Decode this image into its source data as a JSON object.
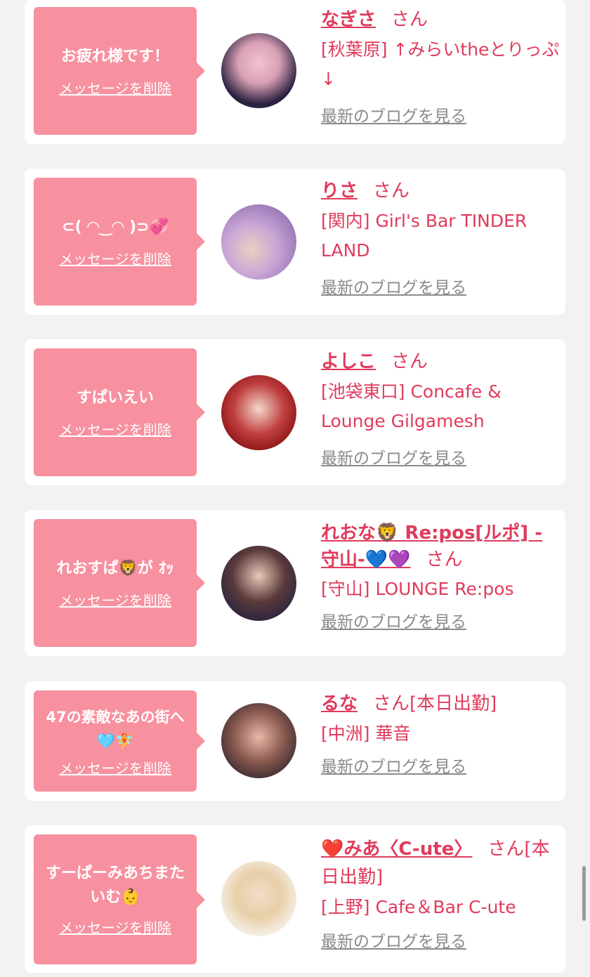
{
  "entries": [
    {
      "message": "お疲れ様です！",
      "delete_label": "メッセージを削除",
      "name": "なぎさ",
      "honorific": "さん",
      "shop": "[秋葉原] ↑みらいtheとりっぷ↓",
      "blog_label": "最新のブログを見る",
      "avatar_colors": [
        "#2a2140",
        "#f0c3d0"
      ]
    },
    {
      "message": "⊂( ◠‿◠ )⊃💞",
      "delete_label": "メッセージを削除",
      "name": "りさ",
      "honorific": "さん",
      "shop": "[関内] Girl's Bar TINDER LAND",
      "blog_label": "最新のブログを見る",
      "avatar_colors": [
        "#b08fc8",
        "#e8d0c0"
      ]
    },
    {
      "message": "すぱいえい",
      "delete_label": "メッセージを削除",
      "name": "よしこ",
      "honorific": "さん",
      "shop": "[池袋東口] Concafe & Lounge Gilgamesh",
      "blog_label": "最新のブログを見る",
      "avatar_colors": [
        "#b01818",
        "#f2d8cc"
      ]
    },
    {
      "message": "れおすぱ🦁が ｵｯ",
      "delete_label": "メッセージを削除",
      "name": "れおな🦁 Re:pos[ルポ] -守山-💙💜",
      "honorific": "さん",
      "shop": "[守山] LOUNGE Re:pos",
      "blog_label": "最新のブログを見る",
      "avatar_colors": [
        "#4a2a2a",
        "#3a3a60"
      ]
    },
    {
      "message": "47の素敵なあの街へ🩵🧚",
      "delete_label": "メッセージを削除",
      "name": "るな",
      "honorific": "さん[本日出勤]",
      "shop": "[中洲] 華音",
      "blog_label": "最新のブログを見る",
      "avatar_colors": [
        "#3a2a30",
        "#e8b8a8"
      ]
    },
    {
      "message": "すーぱーみあちまたいむ👶",
      "delete_label": "メッセージを削除",
      "name": "❤️みあ〈C-ute〉",
      "honorific": "さん[本日出勤]",
      "shop": "[上野] Cafe＆Bar C-ute",
      "blog_label": "最新のブログを見る",
      "avatar_colors": [
        "#f0e4d0",
        "#f3dcc8"
      ]
    }
  ]
}
